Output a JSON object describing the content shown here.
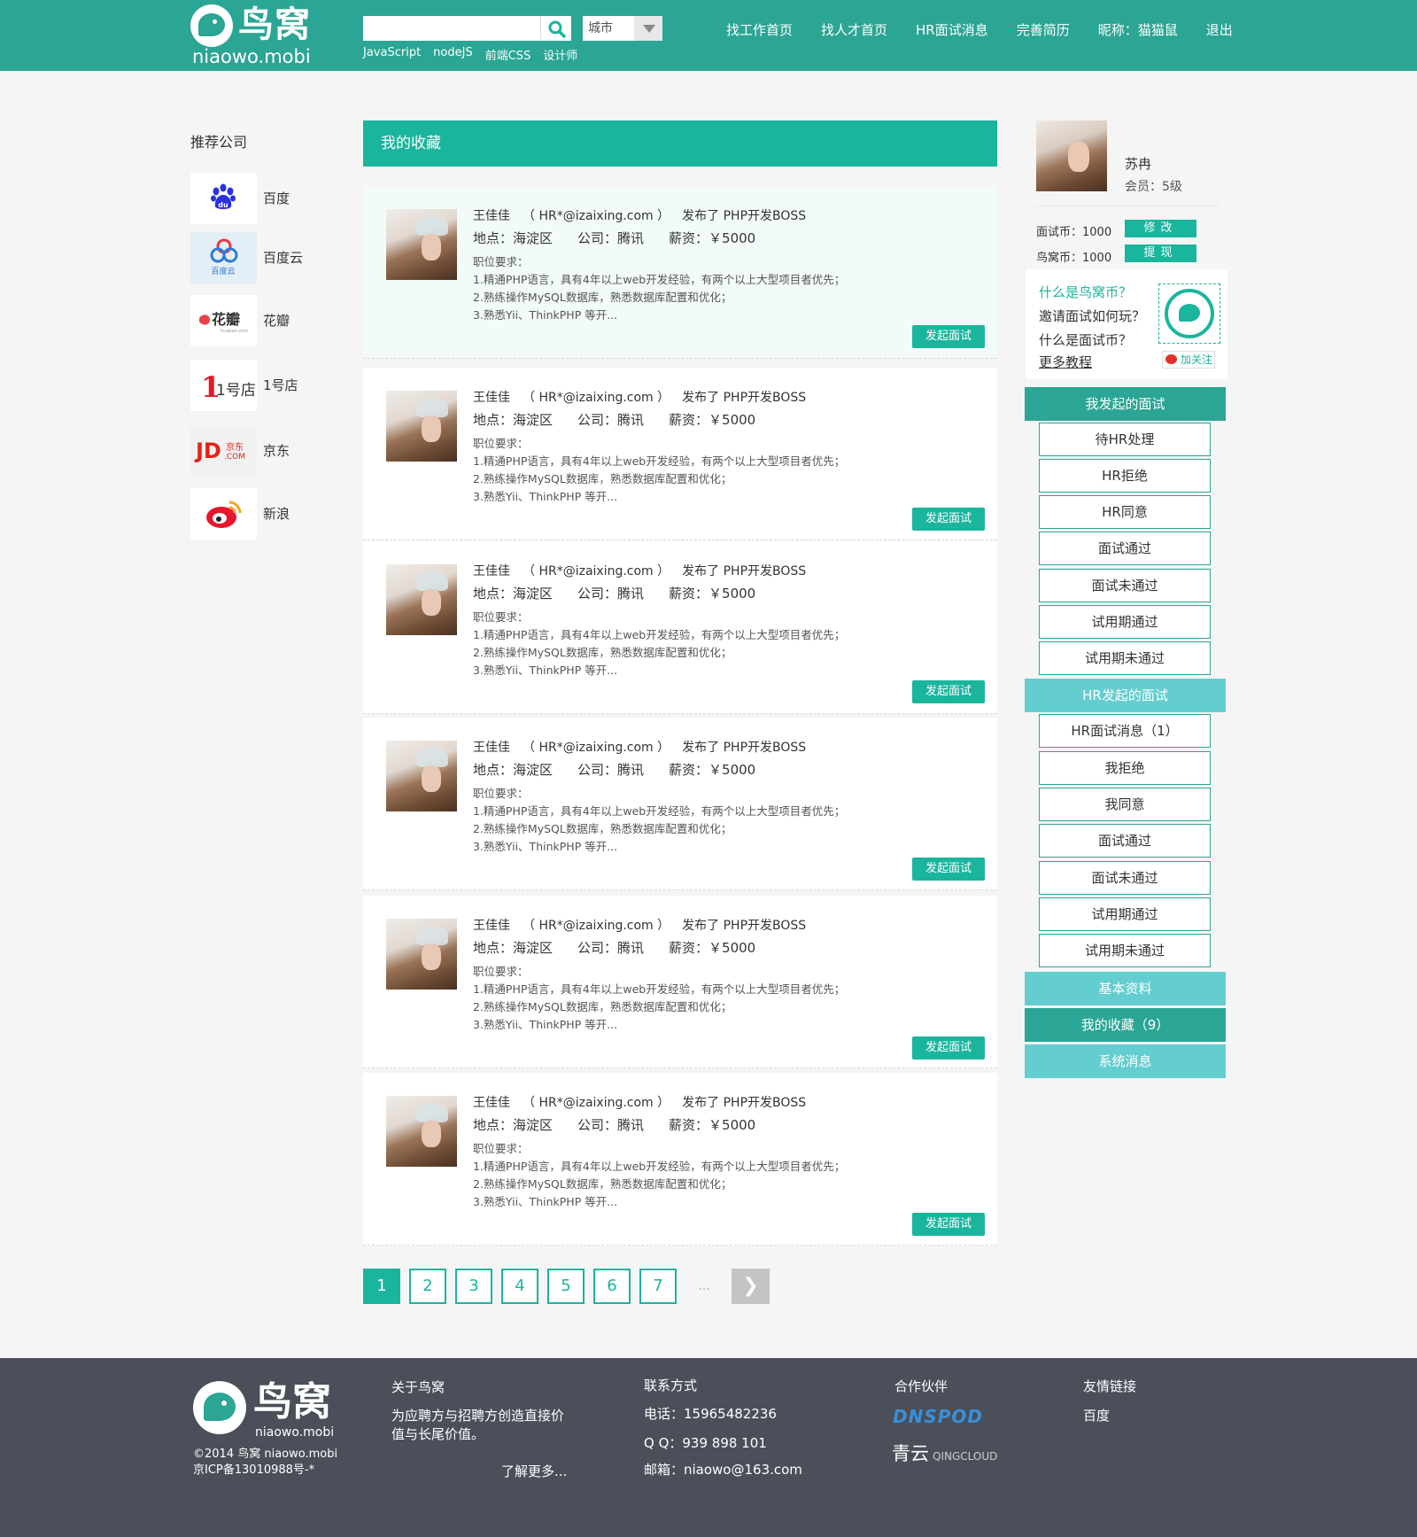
{
  "colors": {
    "brand": "#2ba594",
    "accent": "#1ab59d",
    "light_accent": "#64cdd0",
    "footer_bg": "#4a4f59"
  },
  "header": {
    "logo_cn": "鸟窝",
    "logo_en": "niaowo.mobi",
    "search_placeholder": "",
    "city_label": "城市",
    "hot_tags": [
      "JavaScript",
      "nodeJS",
      "前端CSS",
      "设计师"
    ],
    "nav": [
      "找工作首页",
      "找人才首页",
      "HR面试消息",
      "完善简历",
      "昵称：猫猫鼠",
      "退出"
    ]
  },
  "left": {
    "title": "推荐公司",
    "companies": [
      {
        "name": "百度",
        "icon": "baidu-logo-icon"
      },
      {
        "name": "百度云",
        "icon": "baidu-cloud-logo-icon"
      },
      {
        "name": "花瓣",
        "icon": "huaban-logo-icon"
      },
      {
        "name": "1号店",
        "icon": "yhd-logo-icon"
      },
      {
        "name": "京东",
        "icon": "jd-logo-icon"
      },
      {
        "name": "新浪",
        "icon": "sina-weibo-logo-icon"
      }
    ],
    "logo_texts": {
      "baidu_cloud": "百度云",
      "huaban": "花瓣",
      "huaban_sub": "huaban.com",
      "yhd": "1号店",
      "jd": "JD",
      "jd_cn": "京东",
      "jd_com": ".COM"
    }
  },
  "main": {
    "title": "我的收藏",
    "cards": [
      {
        "hr": "王佳佳",
        "email": "（ HR*@izaixing.com ）",
        "published": "发布了",
        "position": "PHP开发BOSS",
        "location": "地点：海淀区",
        "company": "公司：腾讯",
        "salary": "薪资：￥5000",
        "req_title": "职位要求：",
        "req1": "1.精通PHP语言，具有4年以上web开发经验，有两个以上大型项目者优先；",
        "req2": "2.熟练操作MySQL数据库，熟悉数据库配置和优化；",
        "req3": "3.熟悉Yii、ThinkPHP 等开...",
        "button": "发起面试"
      },
      {
        "hr": "王佳佳",
        "email": "（ HR*@izaixing.com ）",
        "published": "发布了",
        "position": "PHP开发BOSS",
        "location": "地点：海淀区",
        "company": "公司：腾讯",
        "salary": "薪资：￥5000",
        "req_title": "职位要求：",
        "req1": "1.精通PHP语言，具有4年以上web开发经验，有两个以上大型项目者优先；",
        "req2": "2.熟练操作MySQL数据库，熟悉数据库配置和优化；",
        "req3": "3.熟悉Yii、ThinkPHP 等开...",
        "button": "发起面试"
      },
      {
        "hr": "王佳佳",
        "email": "（ HR*@izaixing.com ）",
        "published": "发布了",
        "position": "PHP开发BOSS",
        "location": "地点：海淀区",
        "company": "公司：腾讯",
        "salary": "薪资：￥5000",
        "req_title": "职位要求：",
        "req1": "1.精通PHP语言，具有4年以上web开发经验，有两个以上大型项目者优先；",
        "req2": "2.熟练操作MySQL数据库，熟悉数据库配置和优化；",
        "req3": "3.熟悉Yii、ThinkPHP 等开...",
        "button": "发起面试"
      },
      {
        "hr": "王佳佳",
        "email": "（ HR*@izaixing.com ）",
        "published": "发布了",
        "position": "PHP开发BOSS",
        "location": "地点：海淀区",
        "company": "公司：腾讯",
        "salary": "薪资：￥5000",
        "req_title": "职位要求：",
        "req1": "1.精通PHP语言，具有4年以上web开发经验，有两个以上大型项目者优先；",
        "req2": "2.熟练操作MySQL数据库，熟悉数据库配置和优化；",
        "req3": "3.熟悉Yii、ThinkPHP 等开...",
        "button": "发起面试"
      },
      {
        "hr": "王佳佳",
        "email": "（ HR*@izaixing.com ）",
        "published": "发布了",
        "position": "PHP开发BOSS",
        "location": "地点：海淀区",
        "company": "公司：腾讯",
        "salary": "薪资：￥5000",
        "req_title": "职位要求：",
        "req1": "1.精通PHP语言，具有4年以上web开发经验，有两个以上大型项目者优先；",
        "req2": "2.熟练操作MySQL数据库，熟悉数据库配置和优化；",
        "req3": "3.熟悉Yii、ThinkPHP 等开...",
        "button": "发起面试"
      },
      {
        "hr": "王佳佳",
        "email": "（ HR*@izaixing.com ）",
        "published": "发布了",
        "position": "PHP开发BOSS",
        "location": "地点：海淀区",
        "company": "公司：腾讯",
        "salary": "薪资：￥5000",
        "req_title": "职位要求：",
        "req1": "1.精通PHP语言，具有4年以上web开发经验，有两个以上大型项目者优先；",
        "req2": "2.熟练操作MySQL数据库，熟悉数据库配置和优化；",
        "req3": "3.熟悉Yii、ThinkPHP 等开...",
        "button": "发起面试"
      }
    ],
    "pagination": {
      "pages": [
        "1",
        "2",
        "3",
        "4",
        "5",
        "6",
        "7"
      ],
      "current": "1",
      "dots": "...",
      "next": "❯"
    }
  },
  "right": {
    "user_name": "苏冉",
    "user_level": "会员：5级",
    "interview_coin": "面试币：1000",
    "niaowo_coin": "鸟窝币：1000",
    "modify_btn": "修改",
    "withdraw_btn": "提现",
    "help": [
      "什么是鸟窝币？",
      "邀请面试如何玩？",
      "什么是面试币？",
      "更多教程"
    ],
    "follow": "加关注",
    "my_interviews_head": "我发起的面试",
    "my_interviews": [
      "待HR处理",
      "HR拒绝",
      "HR同意",
      "面试通过",
      "面试未通过",
      "试用期通过",
      "试用期未通过"
    ],
    "hr_interviews_head": "HR发起的面试",
    "hr_interviews": [
      "HR面试消息（1）",
      "我拒绝",
      "我同意",
      "面试通过",
      "面试未通过",
      "试用期通过",
      "试用期未通过"
    ],
    "basic_info": "基本资料",
    "my_favorites": "我的收藏（9）",
    "system_messages": "系统消息"
  },
  "footer": {
    "logo_cn": "鸟窝",
    "logo_en": "niaowo.mobi",
    "copyright": "©2014 鸟窝 niaowo.mobi",
    "icp": "京ICP备13010988号-*",
    "about_title": "关于鸟窝",
    "about_text1": "为应聘方与招聘方创造直接价",
    "about_text2": "值与长尾价值。",
    "about_more": "了解更多...",
    "contact_title": "联系方式",
    "phone": "电话：15965482236",
    "qq": "Q Q：939 898 101",
    "email": "邮箱：niaowo@163.com",
    "partners_title": "合作伙伴",
    "partner1": "DNSPOD",
    "partner2": "青云",
    "partner2_en": "QINGCLOUD",
    "links_title": "友情链接",
    "link1": "百度"
  }
}
